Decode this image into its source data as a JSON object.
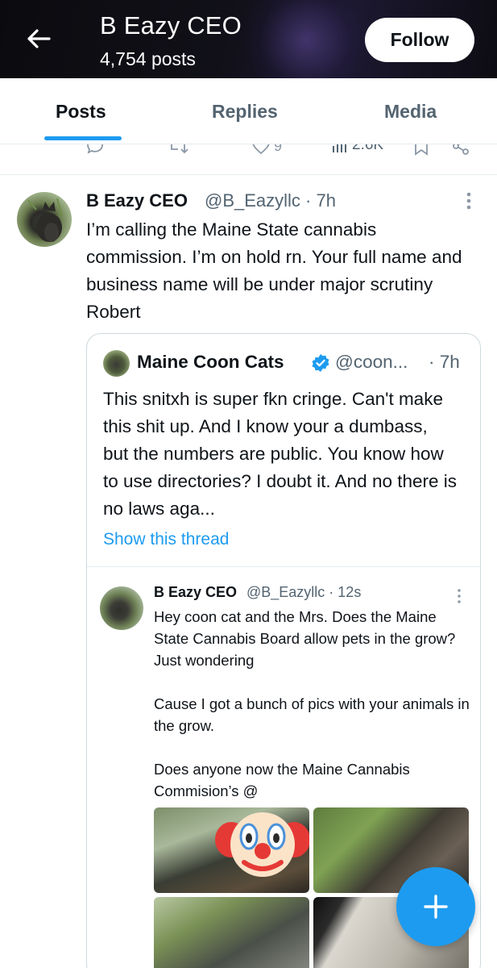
{
  "header": {
    "name": "B Eazy CEO",
    "post_count": "4,754 posts",
    "follow_label": "Follow"
  },
  "tabs": [
    {
      "label": "Posts",
      "active": true
    },
    {
      "label": "Replies",
      "active": false
    },
    {
      "label": "Media",
      "active": false
    }
  ],
  "prev_actions": {
    "likes": "9",
    "views": "2.6K"
  },
  "tweet": {
    "name": "B Eazy CEO",
    "handle": "@B_Eazyllc · 7h",
    "text": "I’m calling the Maine State cannabis commission. I’m on hold rn. Your full name and business name will be under major scrutiny Robert"
  },
  "quote": {
    "name": "Maine Coon Cats",
    "handle": "@coon...",
    "time": "· 7h",
    "text": "This snitxh is super fkn cringe. Can't make this shit up. And I know your a dumbass, but the numbers are public. You know how to use directories? I doubt it. And no there is no laws aga...",
    "show_thread": "Show this thread"
  },
  "embedded": {
    "name": "B Eazy CEO",
    "handle": "@B_Eazyllc · 12s",
    "p1": "Hey coon cat and the Mrs. Does the Maine State Cannabis Board allow pets in the grow? Just wondering",
    "p2": "Cause I got a bunch of pics with your animals in the grow.",
    "p3": "Does anyone now the Maine Cannabis Commision’s @"
  },
  "colors": {
    "accent": "#1d9bf0",
    "text": "#0f1419",
    "secondary": "#536471"
  },
  "icons": [
    "back-arrow-icon",
    "reply-icon",
    "repost-icon",
    "like-icon",
    "views-icon",
    "bookmark-icon",
    "share-icon",
    "more-icon",
    "verified-icon",
    "compose-icon",
    "clown-emoji"
  ]
}
